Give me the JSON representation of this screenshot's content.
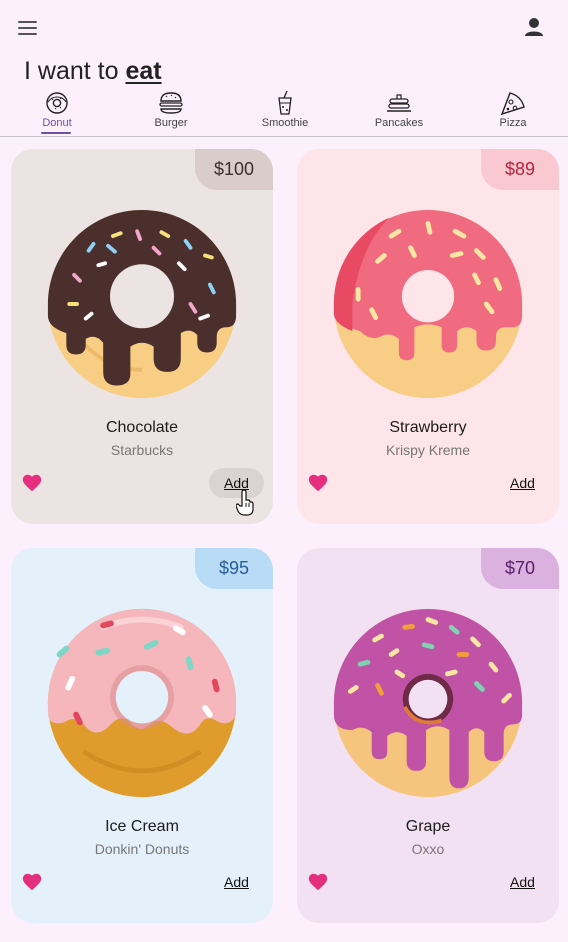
{
  "header": {
    "headline_prefix": "I want to",
    "headline_emphasis": "eat"
  },
  "tabs": [
    {
      "label": "Donut",
      "icon": "donut-icon",
      "active": true
    },
    {
      "label": "Burger",
      "icon": "burger-icon"
    },
    {
      "label": "Smoothie",
      "icon": "smoothie-icon"
    },
    {
      "label": "Pancakes",
      "icon": "pancakes-icon"
    },
    {
      "label": "Pizza",
      "icon": "pizza-icon"
    }
  ],
  "products": [
    {
      "name": "Chocolate",
      "brand": "Starbucks",
      "price": "$100",
      "add_label": "Add",
      "bg": "#ece4e2",
      "tag_bg": "#d9ccca",
      "price_color": "#3a302e",
      "icing": "#4a2f2d",
      "dough": "#f7ce83"
    },
    {
      "name": "Strawberry",
      "brand": "Krispy Kreme",
      "price": "$89",
      "add_label": "Add",
      "bg": "#fde5ea",
      "tag_bg": "#f9c8d1",
      "price_color": "#b3263c",
      "icing": "#f06a80",
      "dough": "#f8cd85"
    },
    {
      "name": "Ice Cream",
      "brand": "Donkin' Donuts",
      "price": "$95",
      "add_label": "Add",
      "bg": "#e4f1fb",
      "tag_bg": "#b9dcf6",
      "price_color": "#2a5c96",
      "icing": "#f5b7bc",
      "dough": "#df9b2c"
    },
    {
      "name": "Grape",
      "brand": "Oxxo",
      "price": "$70",
      "add_label": "Add",
      "bg": "#f2e1f2",
      "tag_bg": "#dab1df",
      "price_color": "#5a1f6c",
      "icing": "#c053a5",
      "dough": "#f6c57d"
    }
  ],
  "colors": {
    "heart": "#e62e7e",
    "accent": "#6b4fa0"
  }
}
